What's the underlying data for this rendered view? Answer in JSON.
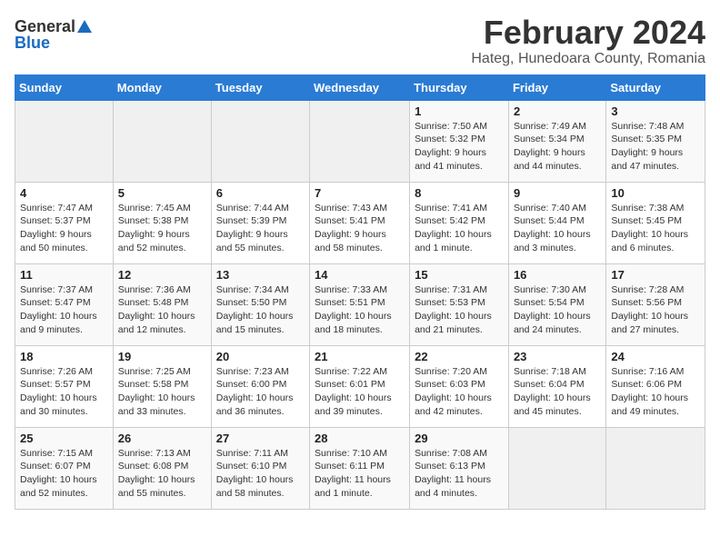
{
  "logo": {
    "general": "General",
    "blue": "Blue"
  },
  "title": {
    "month": "February 2024",
    "location": "Hateg, Hunedoara County, Romania"
  },
  "headers": [
    "Sunday",
    "Monday",
    "Tuesday",
    "Wednesday",
    "Thursday",
    "Friday",
    "Saturday"
  ],
  "weeks": [
    [
      {
        "day": "",
        "detail": ""
      },
      {
        "day": "",
        "detail": ""
      },
      {
        "day": "",
        "detail": ""
      },
      {
        "day": "",
        "detail": ""
      },
      {
        "day": "1",
        "detail": "Sunrise: 7:50 AM\nSunset: 5:32 PM\nDaylight: 9 hours\nand 41 minutes."
      },
      {
        "day": "2",
        "detail": "Sunrise: 7:49 AM\nSunset: 5:34 PM\nDaylight: 9 hours\nand 44 minutes."
      },
      {
        "day": "3",
        "detail": "Sunrise: 7:48 AM\nSunset: 5:35 PM\nDaylight: 9 hours\nand 47 minutes."
      }
    ],
    [
      {
        "day": "4",
        "detail": "Sunrise: 7:47 AM\nSunset: 5:37 PM\nDaylight: 9 hours\nand 50 minutes."
      },
      {
        "day": "5",
        "detail": "Sunrise: 7:45 AM\nSunset: 5:38 PM\nDaylight: 9 hours\nand 52 minutes."
      },
      {
        "day": "6",
        "detail": "Sunrise: 7:44 AM\nSunset: 5:39 PM\nDaylight: 9 hours\nand 55 minutes."
      },
      {
        "day": "7",
        "detail": "Sunrise: 7:43 AM\nSunset: 5:41 PM\nDaylight: 9 hours\nand 58 minutes."
      },
      {
        "day": "8",
        "detail": "Sunrise: 7:41 AM\nSunset: 5:42 PM\nDaylight: 10 hours\nand 1 minute."
      },
      {
        "day": "9",
        "detail": "Sunrise: 7:40 AM\nSunset: 5:44 PM\nDaylight: 10 hours\nand 3 minutes."
      },
      {
        "day": "10",
        "detail": "Sunrise: 7:38 AM\nSunset: 5:45 PM\nDaylight: 10 hours\nand 6 minutes."
      }
    ],
    [
      {
        "day": "11",
        "detail": "Sunrise: 7:37 AM\nSunset: 5:47 PM\nDaylight: 10 hours\nand 9 minutes."
      },
      {
        "day": "12",
        "detail": "Sunrise: 7:36 AM\nSunset: 5:48 PM\nDaylight: 10 hours\nand 12 minutes."
      },
      {
        "day": "13",
        "detail": "Sunrise: 7:34 AM\nSunset: 5:50 PM\nDaylight: 10 hours\nand 15 minutes."
      },
      {
        "day": "14",
        "detail": "Sunrise: 7:33 AM\nSunset: 5:51 PM\nDaylight: 10 hours\nand 18 minutes."
      },
      {
        "day": "15",
        "detail": "Sunrise: 7:31 AM\nSunset: 5:53 PM\nDaylight: 10 hours\nand 21 minutes."
      },
      {
        "day": "16",
        "detail": "Sunrise: 7:30 AM\nSunset: 5:54 PM\nDaylight: 10 hours\nand 24 minutes."
      },
      {
        "day": "17",
        "detail": "Sunrise: 7:28 AM\nSunset: 5:56 PM\nDaylight: 10 hours\nand 27 minutes."
      }
    ],
    [
      {
        "day": "18",
        "detail": "Sunrise: 7:26 AM\nSunset: 5:57 PM\nDaylight: 10 hours\nand 30 minutes."
      },
      {
        "day": "19",
        "detail": "Sunrise: 7:25 AM\nSunset: 5:58 PM\nDaylight: 10 hours\nand 33 minutes."
      },
      {
        "day": "20",
        "detail": "Sunrise: 7:23 AM\nSunset: 6:00 PM\nDaylight: 10 hours\nand 36 minutes."
      },
      {
        "day": "21",
        "detail": "Sunrise: 7:22 AM\nSunset: 6:01 PM\nDaylight: 10 hours\nand 39 minutes."
      },
      {
        "day": "22",
        "detail": "Sunrise: 7:20 AM\nSunset: 6:03 PM\nDaylight: 10 hours\nand 42 minutes."
      },
      {
        "day": "23",
        "detail": "Sunrise: 7:18 AM\nSunset: 6:04 PM\nDaylight: 10 hours\nand 45 minutes."
      },
      {
        "day": "24",
        "detail": "Sunrise: 7:16 AM\nSunset: 6:06 PM\nDaylight: 10 hours\nand 49 minutes."
      }
    ],
    [
      {
        "day": "25",
        "detail": "Sunrise: 7:15 AM\nSunset: 6:07 PM\nDaylight: 10 hours\nand 52 minutes."
      },
      {
        "day": "26",
        "detail": "Sunrise: 7:13 AM\nSunset: 6:08 PM\nDaylight: 10 hours\nand 55 minutes."
      },
      {
        "day": "27",
        "detail": "Sunrise: 7:11 AM\nSunset: 6:10 PM\nDaylight: 10 hours\nand 58 minutes."
      },
      {
        "day": "28",
        "detail": "Sunrise: 7:10 AM\nSunset: 6:11 PM\nDaylight: 11 hours\nand 1 minute."
      },
      {
        "day": "29",
        "detail": "Sunrise: 7:08 AM\nSunset: 6:13 PM\nDaylight: 11 hours\nand 4 minutes."
      },
      {
        "day": "",
        "detail": ""
      },
      {
        "day": "",
        "detail": ""
      }
    ]
  ]
}
